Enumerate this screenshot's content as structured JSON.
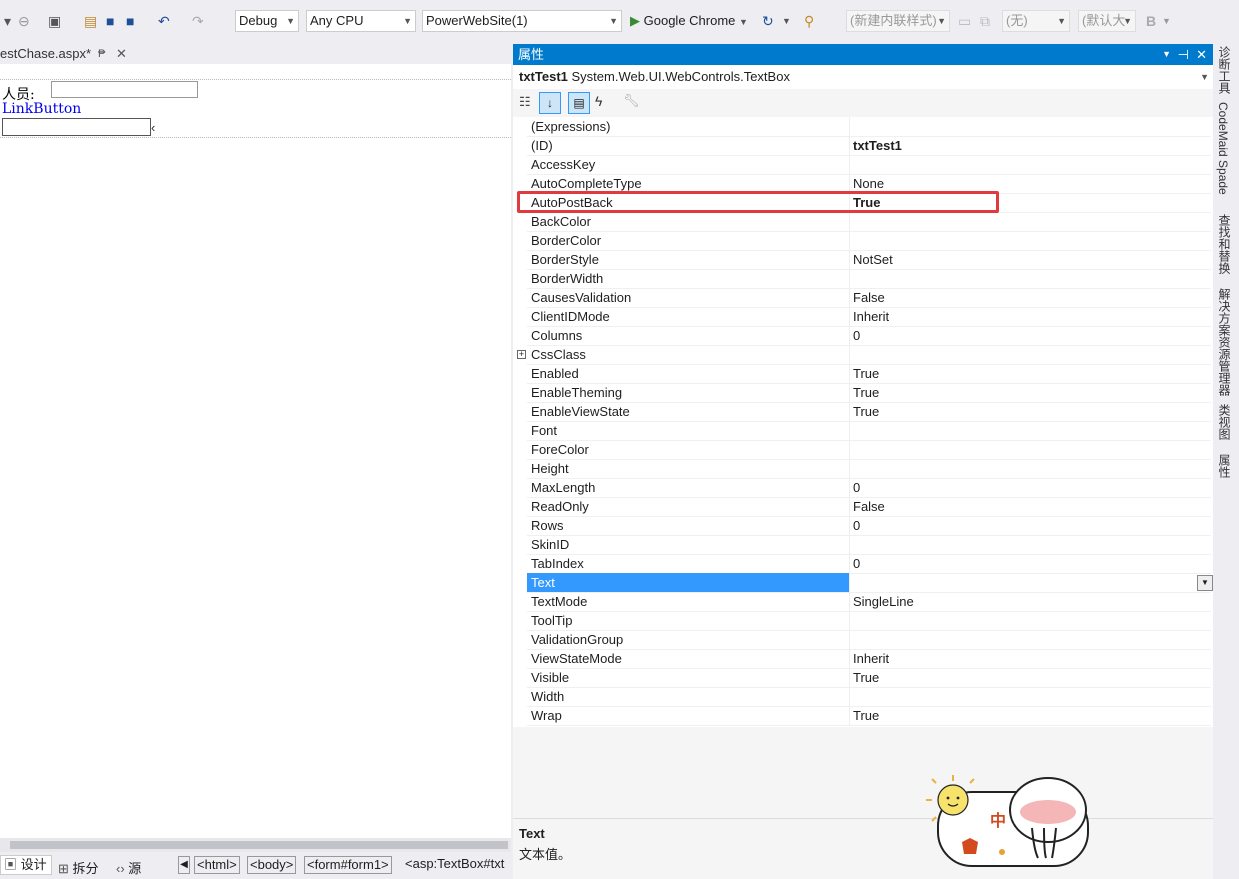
{
  "toolbar": {
    "config": "Debug",
    "platform": "Any CPU",
    "project": "PowerWebSite(1)",
    "run_target": "Google Chrome",
    "style_target": "(新建内联样式)",
    "style_none": "(无)",
    "font_size": "(默认大",
    "bold": "B"
  },
  "doc_tab": {
    "title": "estChase.aspx*"
  },
  "design": {
    "label_person": "人员:",
    "link_button": "LinkButton",
    "cursor_glyph": "‹"
  },
  "bottom": {
    "design": "设计",
    "split": "拆分",
    "source": "源",
    "crumbs": [
      "<html>",
      "<body>",
      "<form#form1>",
      "<asp:TextBox#txt"
    ]
  },
  "props": {
    "title": "属性",
    "object_id": "txtTest1",
    "object_type": "System.Web.UI.WebControls.TextBox",
    "rows": [
      {
        "name": "(Expressions)",
        "value": ""
      },
      {
        "name": "(ID)",
        "value": "txtTest1",
        "bold": true
      },
      {
        "name": "AccessKey",
        "value": ""
      },
      {
        "name": "AutoCompleteType",
        "value": "None"
      },
      {
        "name": "AutoPostBack",
        "value": "True",
        "bold": true,
        "highlight": true
      },
      {
        "name": "BackColor",
        "value": ""
      },
      {
        "name": "BorderColor",
        "value": ""
      },
      {
        "name": "BorderStyle",
        "value": "NotSet"
      },
      {
        "name": "BorderWidth",
        "value": ""
      },
      {
        "name": "CausesValidation",
        "value": "False"
      },
      {
        "name": "ClientIDMode",
        "value": "Inherit"
      },
      {
        "name": "Columns",
        "value": "0"
      },
      {
        "name": "CssClass",
        "value": ""
      },
      {
        "name": "Enabled",
        "value": "True"
      },
      {
        "name": "EnableTheming",
        "value": "True"
      },
      {
        "name": "EnableViewState",
        "value": "True"
      },
      {
        "name": "Font",
        "value": "",
        "expandable": true
      },
      {
        "name": "ForeColor",
        "value": ""
      },
      {
        "name": "Height",
        "value": ""
      },
      {
        "name": "MaxLength",
        "value": "0"
      },
      {
        "name": "ReadOnly",
        "value": "False"
      },
      {
        "name": "Rows",
        "value": "0"
      },
      {
        "name": "SkinID",
        "value": ""
      },
      {
        "name": "TabIndex",
        "value": "0"
      },
      {
        "name": "Text",
        "value": "",
        "selected": true
      },
      {
        "name": "TextMode",
        "value": "SingleLine"
      },
      {
        "name": "ToolTip",
        "value": ""
      },
      {
        "name": "ValidationGroup",
        "value": ""
      },
      {
        "name": "ViewStateMode",
        "value": "Inherit"
      },
      {
        "name": "Visible",
        "value": "True"
      },
      {
        "name": "Width",
        "value": ""
      },
      {
        "name": "Wrap",
        "value": "True"
      }
    ],
    "desc_title": "Text",
    "desc_text": "文本值。"
  },
  "right_dock": [
    "诊断工具",
    "CodeMaid Spade",
    "查找和替换",
    "解决方案资源管理器",
    "类视图",
    "属性"
  ],
  "sticker": {
    "char": "中"
  },
  "colors": {
    "accent": "#007acc",
    "selection": "#3399ff",
    "highlight_box": "#e0393e"
  }
}
